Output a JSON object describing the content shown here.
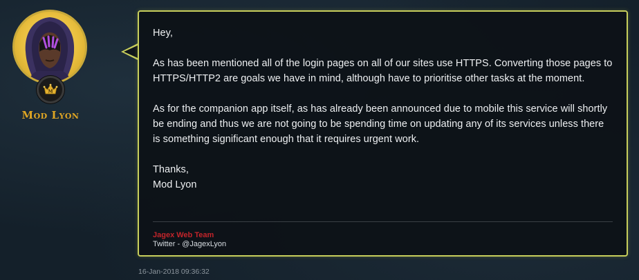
{
  "author": {
    "name": "Mod Lyon",
    "avatar_icon": "hooded-figure-avatar",
    "badge_icon": "crown-icon",
    "badge_letter": "M",
    "name_color": "#e0a623"
  },
  "post": {
    "paragraphs": [
      "Hey,",
      "As has been mentioned all of the login pages on all of our sites use HTTPS. Converting those pages to HTTPS/HTTP2 are goals we have in mind, although have to prioritise other tasks at the moment.",
      "As for the companion app itself, as has already been announced due to mobile this service will shortly be ending and thus we are not going to be spending time on updating any of its services unless there is something significant enough that it requires urgent work.",
      "Thanks,",
      "Mod Lyon"
    ],
    "border_color": "#c8cf5c"
  },
  "signature": {
    "team": "Jagex Web Team",
    "twitter": "Twitter - @JagexLyon",
    "team_color": "#c2242a"
  },
  "timestamp": "16-Jan-2018 09:36:32"
}
